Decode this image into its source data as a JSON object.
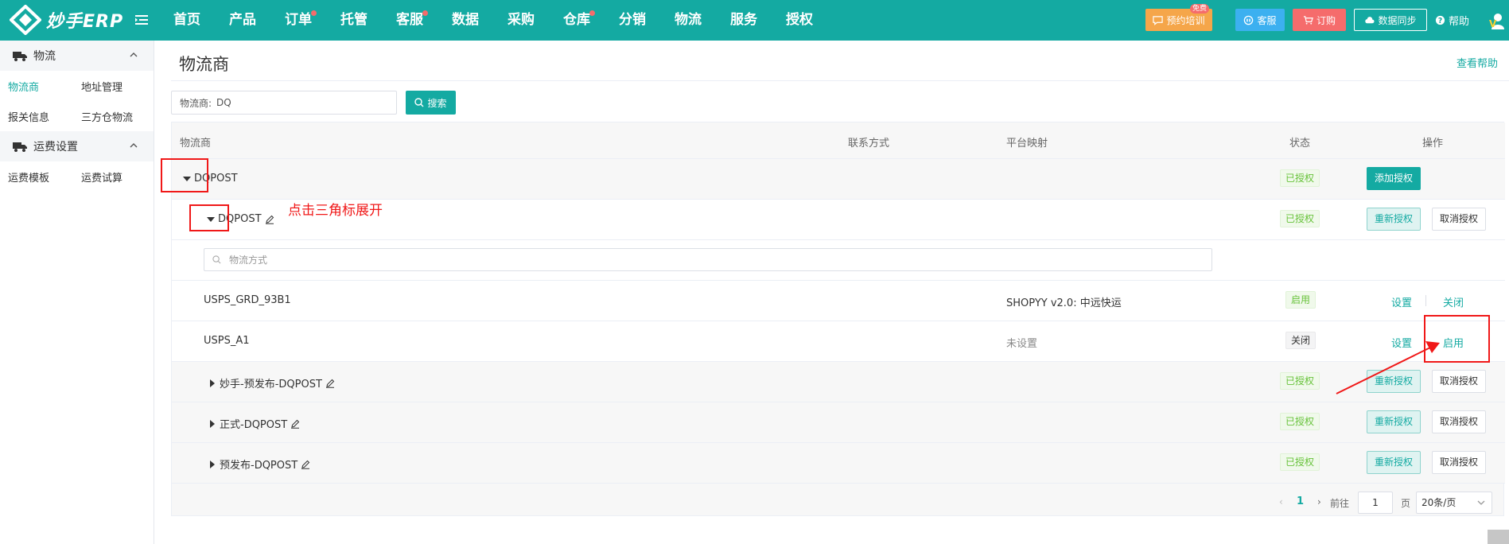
{
  "app": {
    "logo_text": "妙手ERP"
  },
  "nav": {
    "items": [
      {
        "label": "首页",
        "dot": false
      },
      {
        "label": "产品",
        "dot": false
      },
      {
        "label": "订单",
        "dot": true
      },
      {
        "label": "托管",
        "dot": false
      },
      {
        "label": "客服",
        "dot": true
      },
      {
        "label": "数据",
        "dot": false
      },
      {
        "label": "采购",
        "dot": false
      },
      {
        "label": "仓库",
        "dot": true
      },
      {
        "label": "分销",
        "dot": false
      },
      {
        "label": "物流",
        "dot": false
      },
      {
        "label": "服务",
        "dot": false
      },
      {
        "label": "授权",
        "dot": false
      }
    ]
  },
  "top_actions": {
    "training": "预约培训",
    "training_badge": "免费",
    "service": "客服",
    "order": "订购",
    "sync": "数据同步",
    "help": "帮助",
    "avatar_letter": "V"
  },
  "sidebar": {
    "group1": "物流",
    "group1_items": [
      "物流商",
      "地址管理",
      "报关信息",
      "三方仓物流"
    ],
    "group2": "运费设置",
    "group2_items": [
      "运费模板",
      "运费试算"
    ]
  },
  "main": {
    "title": "物流商",
    "help_link": "查看帮助",
    "filter_label": "物流商:",
    "filter_value": "DQ",
    "search_button": "搜索"
  },
  "table": {
    "headers": {
      "provider": "物流商",
      "contact": "联系方式",
      "mapping": "平台映射",
      "status": "状态",
      "action": "操作"
    },
    "provider_row": {
      "name": "DQPOST",
      "status": "已授权",
      "action": "添加授权"
    },
    "account_row": {
      "name": "DQPOST",
      "status": "已授权",
      "reauth": "重新授权",
      "cancel": "取消授权"
    },
    "method_placeholder": "物流方式",
    "methods": [
      {
        "name": "USPS_GRD_93B1",
        "mapping": "SHOPYY v2.0:  中远快运",
        "status": "启用",
        "setup": "设置",
        "toggle": "关闭"
      },
      {
        "name": "USPS_A1",
        "mapping": "未设置",
        "status": "关闭",
        "setup": "设置",
        "toggle": "启用"
      }
    ],
    "other_accounts": [
      {
        "name": "妙手-预发布-DQPOST",
        "status": "已授权",
        "reauth": "重新授权",
        "cancel": "取消授权"
      },
      {
        "name": "正式-DQPOST",
        "status": "已授权",
        "reauth": "重新授权",
        "cancel": "取消授权"
      },
      {
        "name": "预发布-DQPOST",
        "status": "已授权",
        "reauth": "重新授权",
        "cancel": "取消授权"
      }
    ]
  },
  "pagination": {
    "current_page": "1",
    "goto_label": "前往",
    "page_input": "1",
    "page_unit": "页",
    "page_size": "20条/页"
  },
  "annotation": {
    "text": "点击三角标展开"
  },
  "colors": {
    "brand": "#14aaa2",
    "annotation": "#f01818"
  }
}
